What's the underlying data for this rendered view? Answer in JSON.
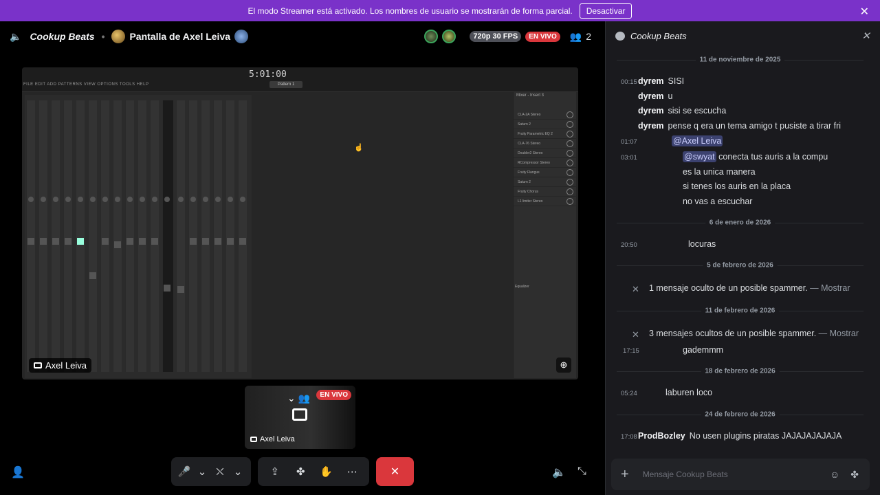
{
  "banner": {
    "text": "El modo Streamer está activado. Los nombres de usuario se mostrarán de forma parcial.",
    "button": "Desactivar",
    "close": "✕"
  },
  "header": {
    "channel": "Cookup Beats",
    "stream_title": "Pantalla de Axel Leiva",
    "quality": "720p 30 FPS",
    "live": "EN VIVO",
    "viewers": "2",
    "speaker_icon": "🔈",
    "viewers_icon": "👥"
  },
  "stream": {
    "daw_time": "5:01:00",
    "daw_menu": "FILE EDIT ADD PATTERNS VIEW OPTIONS TOOLS HELP",
    "pattern": "Pattern 1",
    "mixer_title": "Mixer - Insert 3",
    "slots": [
      "CLA-2A Stereo",
      "Saturn 2",
      "Fruity Parametric EQ 2",
      "CLA-76 Stereo",
      "Doubler2 Stereo",
      "RCompressor Stereo",
      "Fruity Flangus",
      "Saturn 2",
      "Fruity Chorus",
      "L1 limiter Stereo"
    ],
    "eq_label": "Equalizer",
    "tile_label": "Axel Leiva",
    "zoom": "⊕"
  },
  "thumb": {
    "label": "Axel Leiva",
    "live": "EN VIVO"
  },
  "controls": {
    "mic": "🎤",
    "caret": "⌄",
    "camera": "⛌",
    "screen": "⇪",
    "activities": "✤",
    "soundboard": "✋",
    "more": "⋯",
    "leave": "✕",
    "add_user": "👤",
    "volume": "🔈",
    "minimize": "⤡"
  },
  "chat": {
    "title": "Cookup Beats",
    "close": "✕",
    "dates": [
      "11 de noviembre de 2025",
      "6 de enero de 2026",
      "5 de febrero de 2026",
      "11 de febrero de 2026",
      "18 de febrero de 2026",
      "24 de febrero de 2026"
    ],
    "messages": [
      {
        "ts": "00:15",
        "author": "dyrem",
        "text": "SISI"
      },
      {
        "ts": "",
        "author": "dyrem",
        "text": "u"
      },
      {
        "ts": "",
        "author": "dyrem",
        "text": "sisi se escucha"
      },
      {
        "ts": "",
        "author": "dyrem",
        "text": "pense q era un tema amigo t pusiste a tirar fri"
      },
      {
        "ts": "01:07",
        "author": "",
        "mention": "@Axel Leiva",
        "text": ""
      },
      {
        "ts": "03:01",
        "author": "",
        "mention": "@swyat",
        "text": " conecta tus auris a la compu"
      },
      {
        "ts": "",
        "author": "",
        "text": "es la unica manera"
      },
      {
        "ts": "",
        "author": "",
        "text": "si tenes los auris en la placa"
      },
      {
        "ts": "",
        "author": "",
        "text": "no vas a escuchar"
      },
      {
        "ts": "20:50",
        "author": "",
        "text": "locuras"
      },
      {
        "ts": "",
        "author": "",
        "hidden": "1 mensaje oculto de un posible spammer.",
        "show": " — Mostrar"
      },
      {
        "ts": "",
        "author": "",
        "hidden": "3 mensajes ocultos de un posible spammer.",
        "show": " — Mostrar"
      },
      {
        "ts": "17:15",
        "author": "",
        "text": "gademmm"
      },
      {
        "ts": "05:24",
        "author": "",
        "text": "laburen loco"
      },
      {
        "ts": "17:08",
        "author": "ProdBozley",
        "text": "No usen plugins piratas JAJAJAJAJAJA"
      }
    ],
    "composer_placeholder": "Mensaje  Cookup Beats ",
    "plus": "+",
    "emoji": "☺",
    "apps": "✤"
  }
}
